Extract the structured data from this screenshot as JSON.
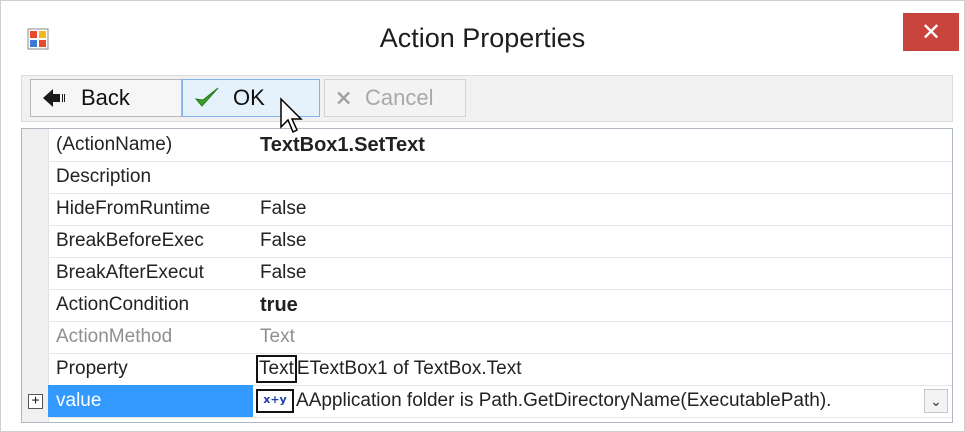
{
  "window": {
    "title": "Action Properties",
    "close_glyph": "✕"
  },
  "toolbar": {
    "back_label": "Back",
    "ok_label": "OK",
    "cancel_label": "Cancel"
  },
  "properties": [
    {
      "name": "(ActionName)",
      "value": "TextBox1.SetText",
      "bold": true
    },
    {
      "name": "Description",
      "value": ""
    },
    {
      "name": "HideFromRuntime",
      "value": "False"
    },
    {
      "name": "BreakBeforeExec",
      "value": "False"
    },
    {
      "name": "BreakAfterExecut",
      "value": "False"
    },
    {
      "name": "ActionCondition",
      "value": "true",
      "bold": true
    },
    {
      "name": "ActionMethod",
      "value": "Text",
      "gray": true
    },
    {
      "name": "Property",
      "value_prefix": "Text",
      "value_mid": "E",
      "value": "TextBox1 of TextBox.Text"
    },
    {
      "name": "value",
      "value_prefix": "A",
      "value": "Application folder is Path.GetDirectoryName(ExecutablePath).",
      "selected": true
    }
  ],
  "icons": {
    "app": "app-window-icon",
    "back": "back-arrow-icon",
    "ok": "checkmark-icon",
    "cancel": "x-cancel-icon",
    "expand": "plus-expander-icon",
    "dropdown": "chevron-down-icon",
    "cursor": "mouse-pointer-icon"
  },
  "glyphs": {
    "expand": "+",
    "dropdown": "⌄",
    "xy_icon": "x+y"
  },
  "colors": {
    "selection": "#3399ff",
    "close": "#c9443c",
    "ok_check": "#3aa02a"
  }
}
